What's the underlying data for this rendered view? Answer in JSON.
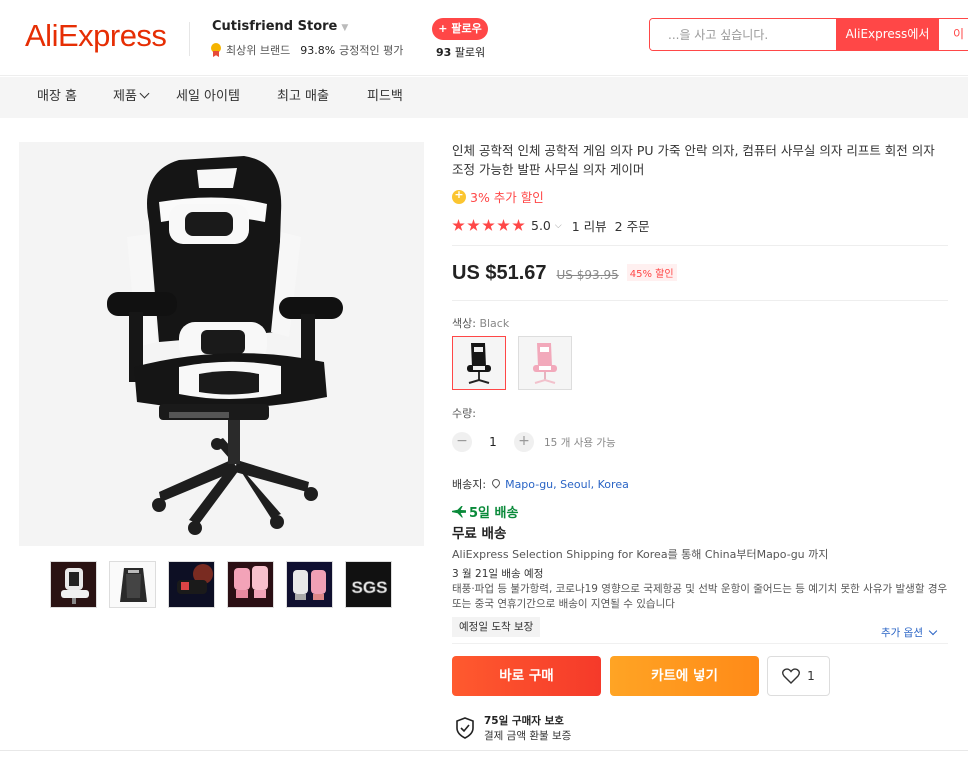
{
  "header": {
    "logo": "AliExpress",
    "store_name": "Cutisfriend Store",
    "store_badge": "최상위 브랜드",
    "positive_pct": "93.8%",
    "positive_label": "긍정적인 평가",
    "follow_label": "+ 팔로우",
    "followers_count": "93",
    "followers_label": "팔로워",
    "search_placeholder": "...을 사고 싶습니다.",
    "search_btn_ali": "AliExpress에서",
    "search_btn_store": "이 스토어"
  },
  "nav": {
    "items": [
      "매장 홈",
      "제품",
      "세일 아이템",
      "최고 매출",
      "피드백"
    ]
  },
  "product": {
    "title": "인체 공학적 인체 공학적 게임 의자 PU 가죽 안락 의자, 컴퓨터 사무실 의자 리프트 회전 의자 조정 가능한 발판 사무실 의자 게이머",
    "coin_discount": "3% 추가 할인",
    "rating": "5.0",
    "reviews": "1 리뷰",
    "orders": "2 주문",
    "price": "US $51.67",
    "old_price": "US $93.95",
    "discount": "45% 할인",
    "color_label": "색상:",
    "color_value": "Black",
    "qty_label": "수량:",
    "qty_value": "1",
    "qty_available": "15 개 사용 가능",
    "ship_to_label": "배송지:",
    "ship_to_location": "Mapo-gu, Seoul, Korea",
    "fast_delivery": "5일 배송",
    "free_shipping": "무료 배송",
    "shipping_via": "AliExpress Selection Shipping for Korea를 통해 China부터Mapo-gu 까지",
    "eta": "3 월 21일 배송 예정",
    "notice": "태풍·파업 등 불가항력, 코로나19 영향으로 국제항공 및 선박 운항이 줄어드는 등 예기치 못한 사유가 발생할 경우 또는 중국 연휴기간으로 배송이 지연될 수 있습니다",
    "guarantee_tag": "예정일 도착 보장",
    "more_options": "추가 옵션",
    "buy_now": "바로 구매",
    "add_to_cart": "카트에 넣기",
    "wishlist_count": "1",
    "protection_title": "75일 구매자 보호",
    "protection_desc": "결제 금액 환불 보증"
  },
  "colors": {
    "brand_red": "#e62e04",
    "accent_red": "#ff4747",
    "buy_button": "#f7432b",
    "cart_button": "#ff9a1f",
    "link_blue": "#2a64c5",
    "delivery_green": "#0a8a3a"
  }
}
